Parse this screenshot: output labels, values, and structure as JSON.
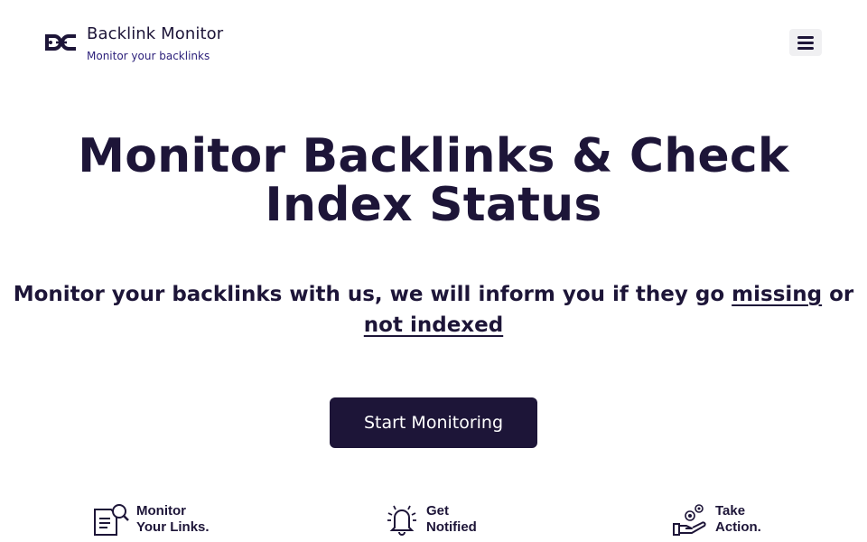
{
  "header": {
    "brand_title": "Backlink Monitor",
    "brand_subtitle": "Monitor your backlinks",
    "logo_icon": "chain-link-icon",
    "menu_icon": "hamburger-menu-icon"
  },
  "hero": {
    "title": "Monitor Backlinks & Check Index Status",
    "subtitle_prefix": "Monitor your backlinks with us, we will inform you if they go",
    "link_missing": "missing",
    "subtitle_or": "or",
    "link_not_indexed": "not indexed",
    "cta_label": "Start Monitoring"
  },
  "features": [
    {
      "icon": "document-search-icon",
      "line1": "Monitor",
      "line2": "Your Links."
    },
    {
      "icon": "bell-icon",
      "line1": "Get",
      "line2": "Notified"
    },
    {
      "icon": "hand-gear-icon",
      "line1": "Take",
      "line2": "Action."
    }
  ],
  "colors": {
    "primary": "#1d1538",
    "accent": "#2b1f7a",
    "background": "#ffffff",
    "menu_bg": "#f0f0f2"
  }
}
